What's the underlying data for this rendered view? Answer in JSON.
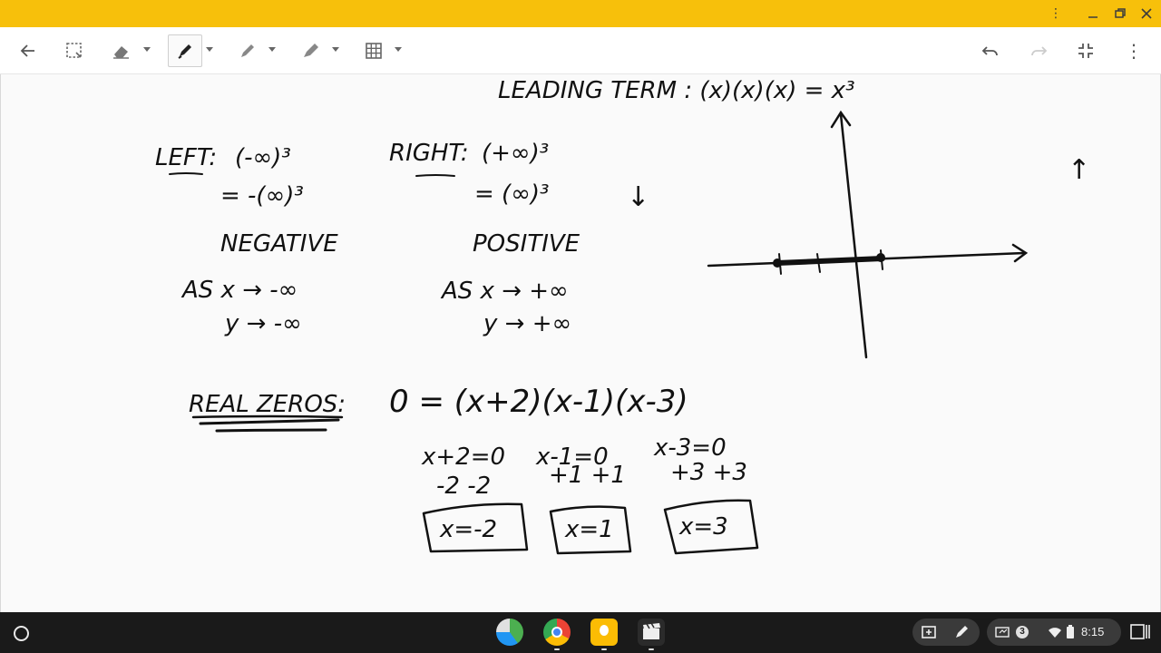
{
  "window": {
    "titlebar_color": "#f7c00b",
    "controls": [
      "more-vert-icon",
      "minimize-icon",
      "restore-icon",
      "close-icon"
    ]
  },
  "toolbar": {
    "tools": [
      {
        "name": "back-arrow-icon"
      },
      {
        "name": "lasso-select-icon"
      },
      {
        "name": "eraser-icon"
      },
      {
        "name": "marker-pen-icon",
        "active": true
      },
      {
        "name": "pencil-icon"
      },
      {
        "name": "highlighter-icon"
      },
      {
        "name": "grid-icon"
      },
      {
        "name": "undo-icon"
      },
      {
        "name": "redo-icon"
      },
      {
        "name": "exit-fullscreen-icon"
      },
      {
        "name": "more-vert-icon"
      }
    ]
  },
  "canvas": {
    "heading": "LEADING TERM : (x)(x)(x) = x³",
    "left_block": {
      "label": "LEFT:",
      "line1": "(-∞)³",
      "line2": "= -(∞)³",
      "sign": "NEGATIVE",
      "limit_x": "AS x → -∞",
      "limit_y": "y → -∞"
    },
    "right_block": {
      "label": "RIGHT:",
      "line1": "(+∞)³",
      "line2": "= (∞)³",
      "sign": "POSITIVE",
      "limit_x": "AS x → +∞",
      "limit_y": "y → +∞"
    },
    "arrows": {
      "down": "↓",
      "up": "↑"
    },
    "zeros": {
      "label": "REAL ZEROS:",
      "equation": "0 = (x+2)(x-1)(x-3)",
      "steps": [
        {
          "eq": "x+2=0",
          "op": "-2  -2",
          "result": "x=-2"
        },
        {
          "eq": "x-1=0",
          "op": "+1  +1",
          "result": "x=1"
        },
        {
          "eq": "x-3=0",
          "op": "+3  +3",
          "result": "x=3"
        }
      ]
    }
  },
  "shelf": {
    "apps": [
      "maps-icon",
      "chrome-icon",
      "keep-icon",
      "video-icon"
    ],
    "tray": {
      "notification_count": "3",
      "time": "8:15"
    }
  }
}
